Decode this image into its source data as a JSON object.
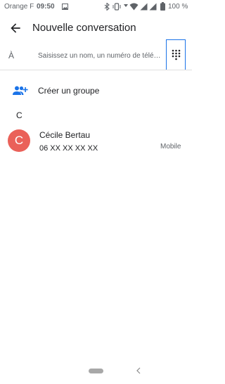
{
  "status_bar": {
    "carrier": "Orange F",
    "time": "09:50",
    "battery": "100 %"
  },
  "header": {
    "title": "Nouvelle conversation",
    "back_icon": "arrow-back-icon"
  },
  "recipient": {
    "label": "À",
    "placeholder": "Saisissez un nom, un numéro de télé…",
    "dialpad_icon": "dialpad-icon"
  },
  "create_group": {
    "label": "Créer un groupe",
    "icon": "group-add-icon"
  },
  "contacts_section": {
    "letter": "C",
    "items": [
      {
        "initial": "C",
        "name": "Cécile Bertau",
        "number": "06 XX XX XX XX",
        "type": "Mobile",
        "avatar_color": "#ea6159"
      }
    ]
  },
  "colors": {
    "accent": "#1a73e8",
    "text": "#202124",
    "secondary_text": "#5f6368"
  }
}
